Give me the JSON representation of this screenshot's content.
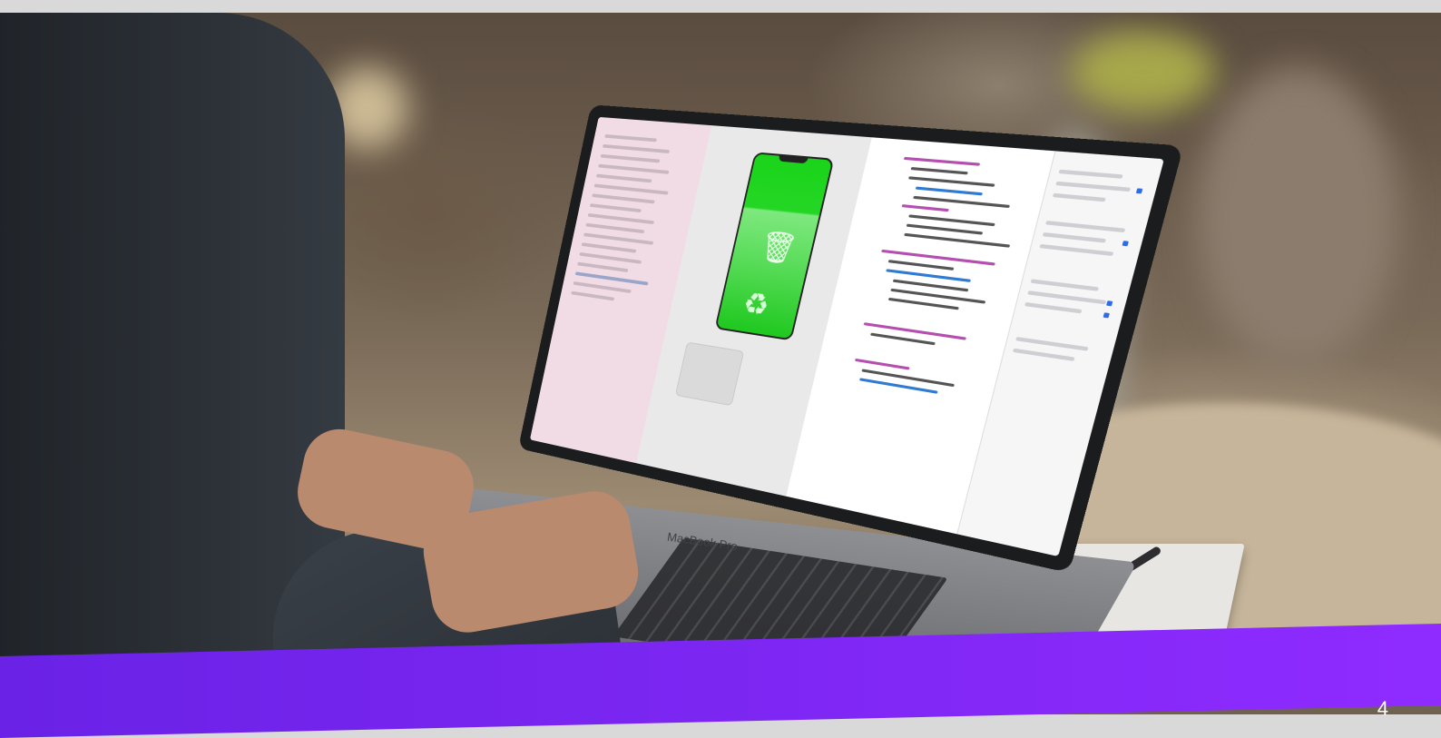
{
  "scene": {
    "laptop_brand": "MacBook Pro",
    "corner_mark": "4"
  },
  "colors": {
    "banner_start": "#6a22e6",
    "banner_end": "#8f2bff",
    "app_preview_green": "#1ad41a",
    "navigator_pink": "#f1dbe4"
  },
  "icons": {
    "trash": "trash-icon",
    "recycle": "recycle-icon",
    "pen": "pen-icon"
  }
}
